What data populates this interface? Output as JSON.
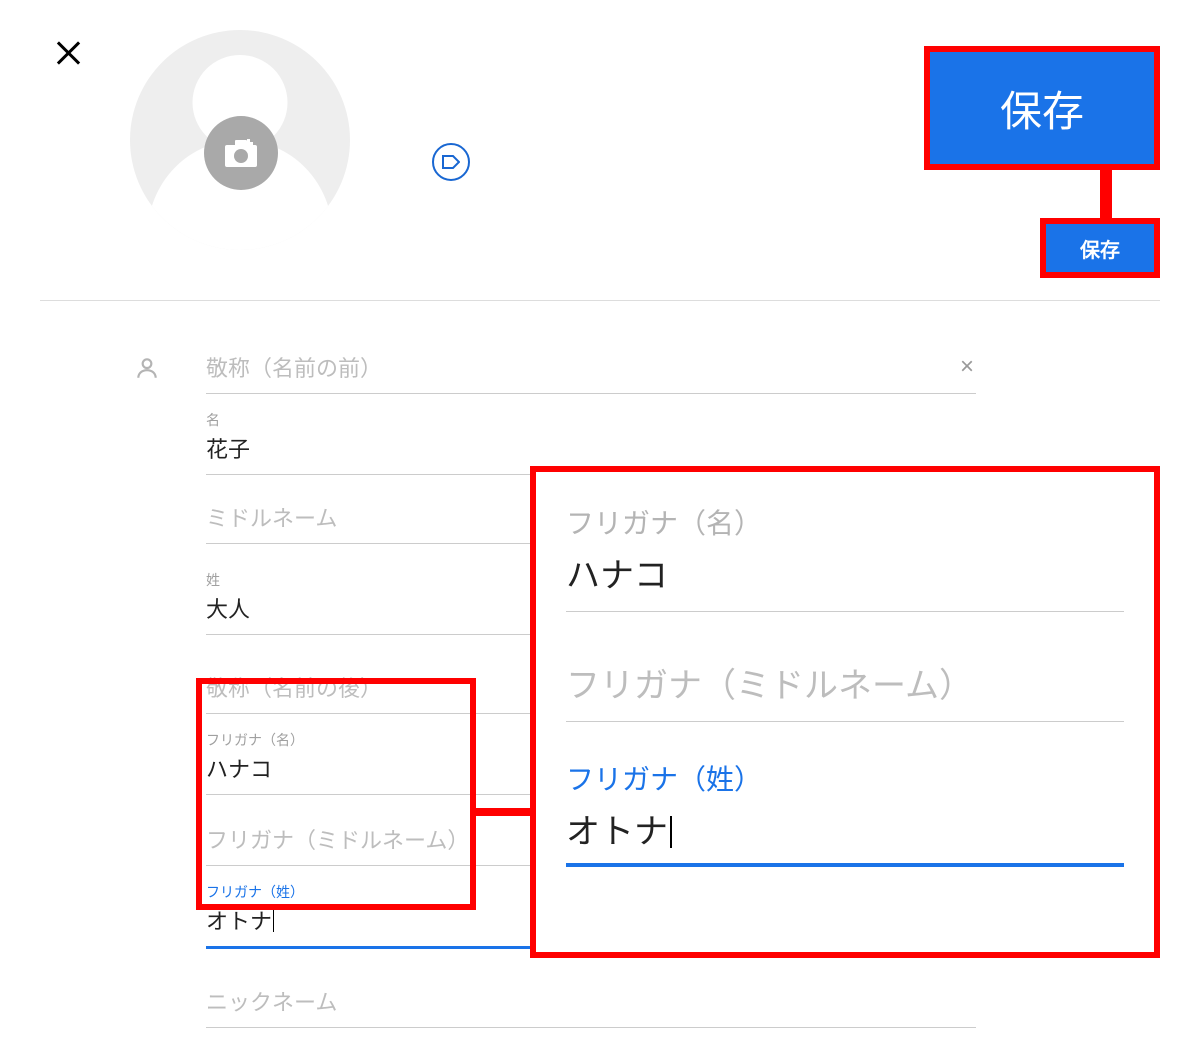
{
  "header": {
    "save_label": "保存",
    "save_label_small": "保存"
  },
  "fields": {
    "prefix": {
      "placeholder": "敬称（名前の前）"
    },
    "given": {
      "label": "名",
      "value": "花子"
    },
    "middle": {
      "placeholder": "ミドルネーム"
    },
    "family": {
      "label": "姓",
      "value": "大人"
    },
    "suffix": {
      "placeholder": "敬称（名前の後）"
    },
    "phonetic_given": {
      "label": "フリガナ（名）",
      "value": "ハナコ"
    },
    "phonetic_middle": {
      "placeholder": "フリガナ（ミドルネーム）"
    },
    "phonetic_family": {
      "label": "フリガナ（姓）",
      "value": "オトナ"
    },
    "nickname": {
      "placeholder": "ニックネーム"
    }
  },
  "magnified": {
    "phonetic_given": {
      "label": "フリガナ（名）",
      "value": "ハナコ"
    },
    "phonetic_middle_placeholder": "フリガナ（ミドルネーム）",
    "phonetic_family": {
      "label": "フリガナ（姓）",
      "value": "オトナ"
    }
  }
}
